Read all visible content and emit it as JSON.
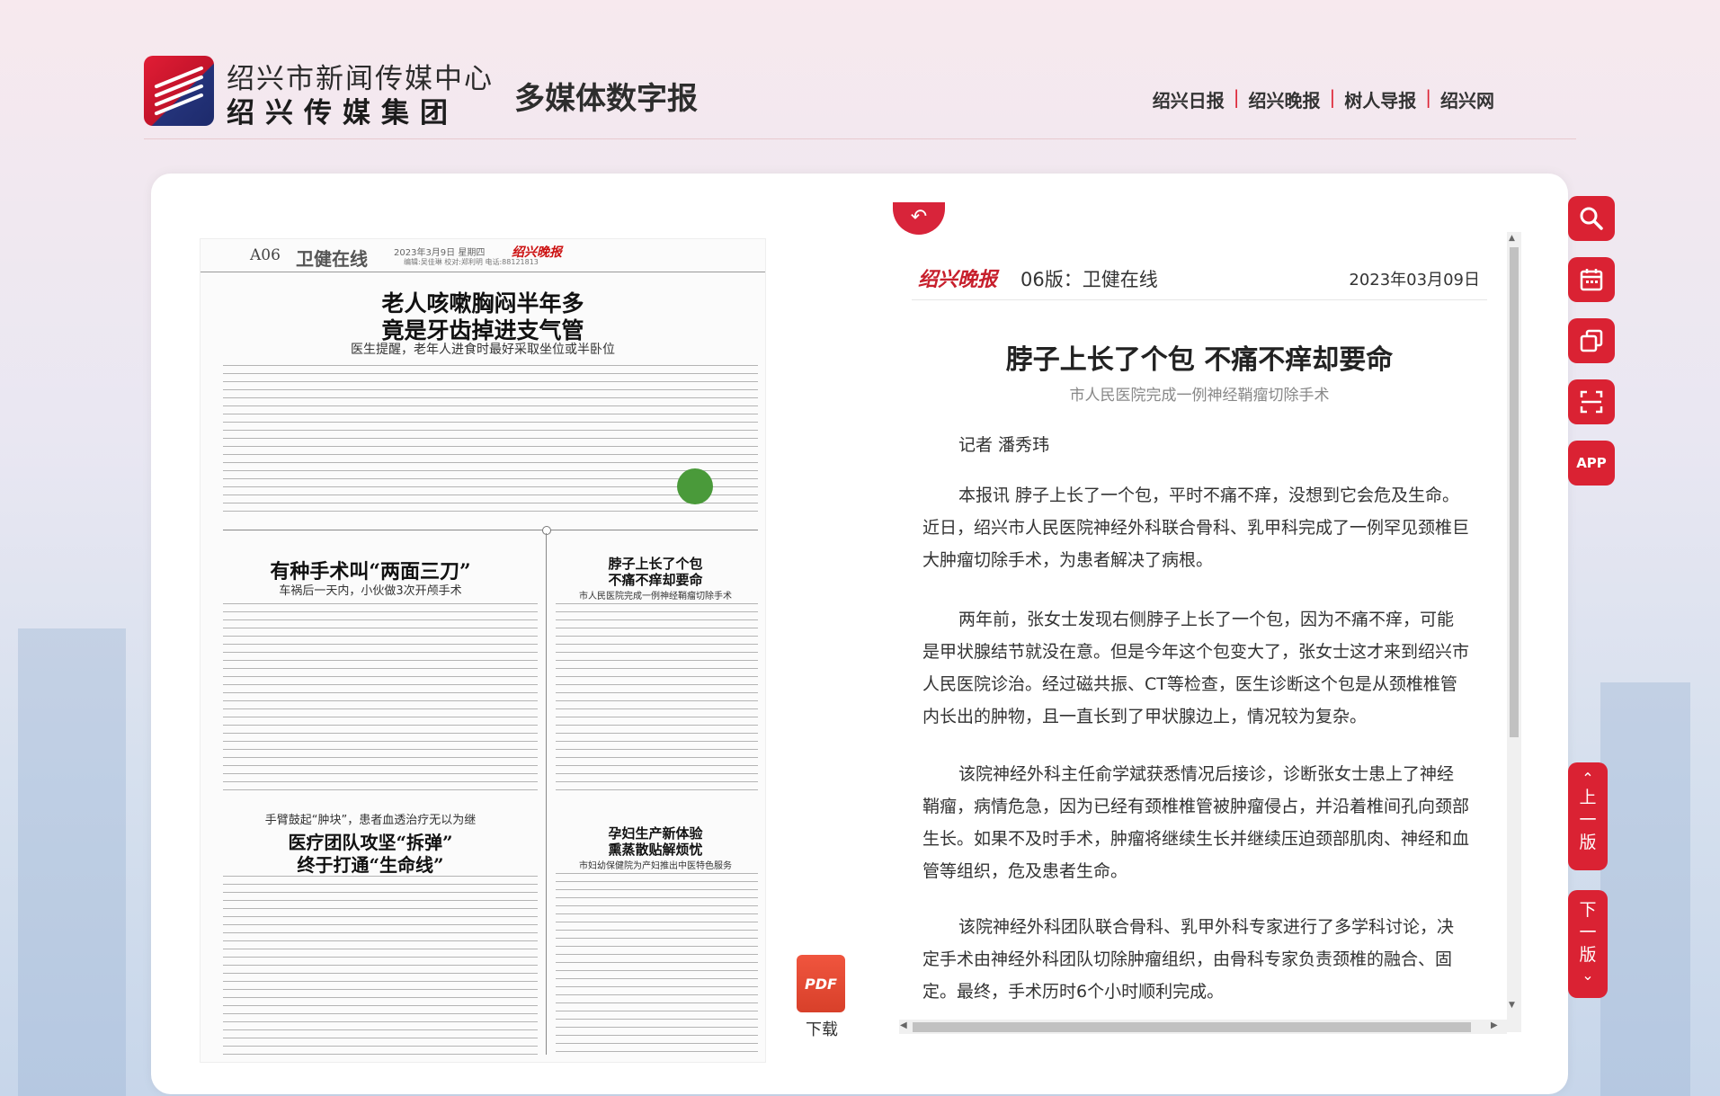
{
  "header": {
    "org_line1": "绍兴市新闻传媒中心",
    "org_line2": "绍兴传媒集团",
    "app_name": "多媒体数字报",
    "nav_links": [
      "绍兴日报",
      "绍兴晚报",
      "树人导报",
      "绍兴网"
    ],
    "nav_separator": "|"
  },
  "newspaper_page": {
    "page_no": "A06",
    "section": "卫健在线",
    "date_line": "2023年3月9日 星期四",
    "masthead": "绍兴晚报",
    "editor_line": "编辑:吴佳琳 校对:郑利明 电话:88121813",
    "articles": [
      {
        "headline_1": "老人咳嗽胸闷半年多",
        "headline_2": "竟是牙齿掉进支气管",
        "subhead": "医生提醒，老年人进食时最好采取坐位或半卧位"
      },
      {
        "headline_1": "有种手术叫“两面三刀”",
        "subhead": "车祸后一天内，小伙做3次开颅手术"
      },
      {
        "headline_1": "脖子上长了个包",
        "headline_2": "不痛不痒却要命",
        "subhead": "市人民医院完成一例神经鞘瘤切除手术"
      },
      {
        "kicker": "手臂鼓起“肿块”，患者血透治疗无以为继",
        "headline_1": "医疗团队攻坚“拆弹”",
        "headline_2": "终于打通“生命线”"
      },
      {
        "headline_1": "孕妇生产新体验",
        "headline_2": "熏蒸散贴解烦忧",
        "subhead": "市妇幼保健院为产妇推出中医特色服务"
      }
    ]
  },
  "download": {
    "icon_text": "PDF",
    "label": "下载"
  },
  "article": {
    "masthead": "绍兴晚报",
    "edition": "06版：卫健在线",
    "date": "2023年03月09日",
    "title": "脖子上长了个包 不痛不痒却要命",
    "subtitle": "市人民医院完成一例神经鞘瘤切除手术",
    "byline": "记者 潘秀玮",
    "paragraphs": [
      "本报讯 脖子上长了一个包，平时不痛不痒，没想到它会危及生命。近日，绍兴市人民医院神经外科联合骨科、乳甲科完成了一例罕见颈椎巨大肿瘤切除手术，为患者解决了病根。",
      "两年前，张女士发现右侧脖子上长了一个包，因为不痛不痒，可能是甲状腺结节就没在意。但是今年这个包变大了，张女士这才来到绍兴市人民医院诊治。经过磁共振、CT等检查，医生诊断这个包是从颈椎椎管内长出的肿物，且一直长到了甲状腺边上，情况较为复杂。",
      "该院神经外科主任俞学斌获悉情况后接诊，诊断张女士患上了神经鞘瘤，病情危急，因为已经有颈椎椎管被肿瘤侵占，并沿着椎间孔向颈部生长。如果不及时手术，肿瘤将继续生长并继续压迫颈部肌肉、神经和血管等组织，危及患者生命。",
      "该院神经外科团队联合骨科、乳甲外科专家进行了多学科讨论，决定手术由神经外科团队切除肿瘤组织，由骨科专家负责颈椎的融合、固定。最终，手术历时6个小时顺利完成。"
    ]
  },
  "toolbar": {
    "app_label": "APP",
    "prev_page": [
      "上",
      "一",
      "版"
    ],
    "next_page": [
      "下",
      "一",
      "版"
    ]
  },
  "colors": {
    "accent": "#da2233",
    "masthead": "#c71f2c"
  }
}
